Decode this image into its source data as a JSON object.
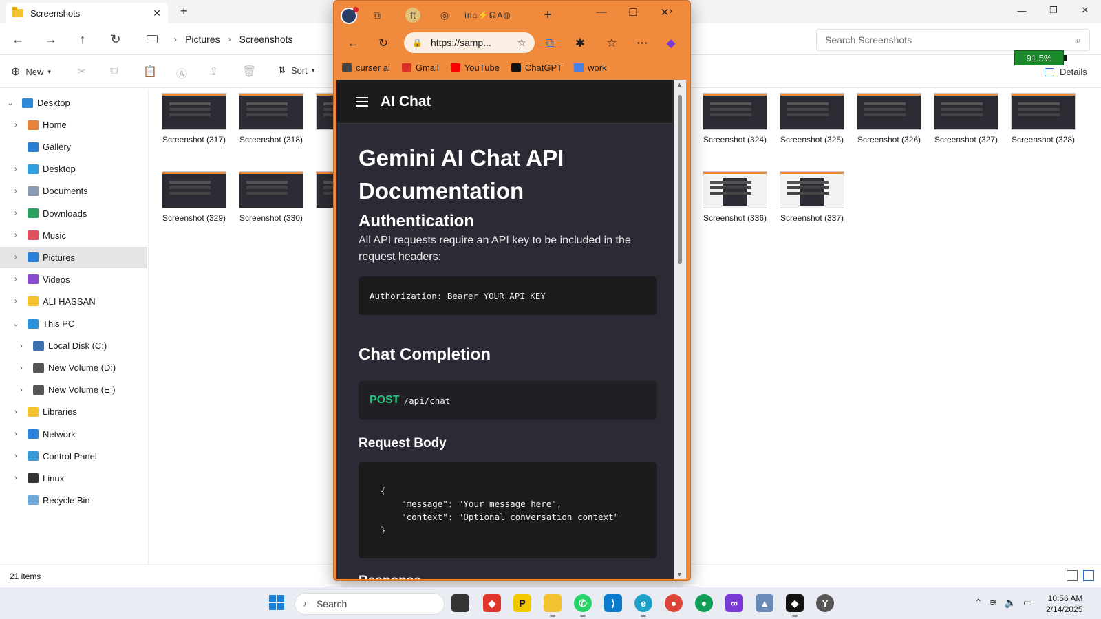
{
  "explorer": {
    "tab_title": "Screenshots",
    "breadcrumb": [
      "Pictures",
      "Screenshots"
    ],
    "search_placeholder": "Search Screenshots",
    "toolbar": {
      "new_label": "New",
      "sort_label": "Sort",
      "details_label": "Details"
    },
    "battery": "91.5%",
    "sidebar": [
      {
        "label": "Desktop",
        "color": "#2f8bd8"
      },
      {
        "label": "Home",
        "color": "#e8823a"
      },
      {
        "label": "Gallery",
        "color": "#2a7fd4"
      },
      {
        "label": "Desktop",
        "color": "#2f9fe0"
      },
      {
        "label": "Documents",
        "color": "#8a9ab0"
      },
      {
        "label": "Downloads",
        "color": "#2aa060"
      },
      {
        "label": "Music",
        "color": "#e0505a"
      },
      {
        "label": "Pictures",
        "color": "#2a80d8"
      },
      {
        "label": "Videos",
        "color": "#8a4ad0"
      },
      {
        "label": "ALI HASSAN",
        "color": "#f2c230"
      },
      {
        "label": "This PC",
        "color": "#2a90d8"
      },
      {
        "label": "Local Disk (C:)",
        "color": "#3a6fb0"
      },
      {
        "label": "New Volume (D:)",
        "color": "#555555"
      },
      {
        "label": "New Volume (E:)",
        "color": "#555555"
      },
      {
        "label": "Libraries",
        "color": "#f2c230"
      },
      {
        "label": "Network",
        "color": "#2a80d8"
      },
      {
        "label": "Control Panel",
        "color": "#3a9ad8"
      },
      {
        "label": "Linux",
        "color": "#333333"
      },
      {
        "label": "Recycle Bin",
        "color": "#6fa8d8"
      }
    ],
    "files_row1": [
      "Screenshot (317)",
      "Screenshot (318)",
      "Scr",
      "3)",
      "Screenshot (324)",
      "Screenshot (325)",
      "Screenshot (326)",
      "Screenshot (327)",
      "Screenshot (328)"
    ],
    "files_row2": [
      "Screenshot (329)",
      "Screenshot (330)",
      "Scr",
      "5)",
      "Screenshot (336)",
      "Screenshot (337)"
    ],
    "status_count": "21 items"
  },
  "browser": {
    "url": "https://samp...",
    "bookmarks": [
      {
        "label": "curser ai",
        "color": "#444444"
      },
      {
        "label": "Gmail",
        "color": "#d93025"
      },
      {
        "label": "YouTube",
        "color": "#ff0000"
      },
      {
        "label": "ChatGPT",
        "color": "#111111"
      },
      {
        "label": "work",
        "color": "#4a7fe0"
      }
    ],
    "page": {
      "app_title": "AI Chat",
      "doc_title": "Gemini AI Chat API Documentation",
      "auth_heading": "Authentication",
      "auth_text": "All API requests require an API key to be included in the request headers:",
      "auth_code": "Authorization: Bearer YOUR_API_KEY",
      "chat_heading": "Chat Completion",
      "method": "POST",
      "endpoint": "/api/chat",
      "request_heading": "Request Body",
      "request_code": "{\n    \"message\": \"Your message here\",\n    \"context\": \"Optional conversation context\"\n}",
      "response_heading": "Response"
    }
  },
  "taskbar": {
    "search_placeholder": "Search",
    "time": "10:56 AM",
    "date": "2/14/2025"
  }
}
